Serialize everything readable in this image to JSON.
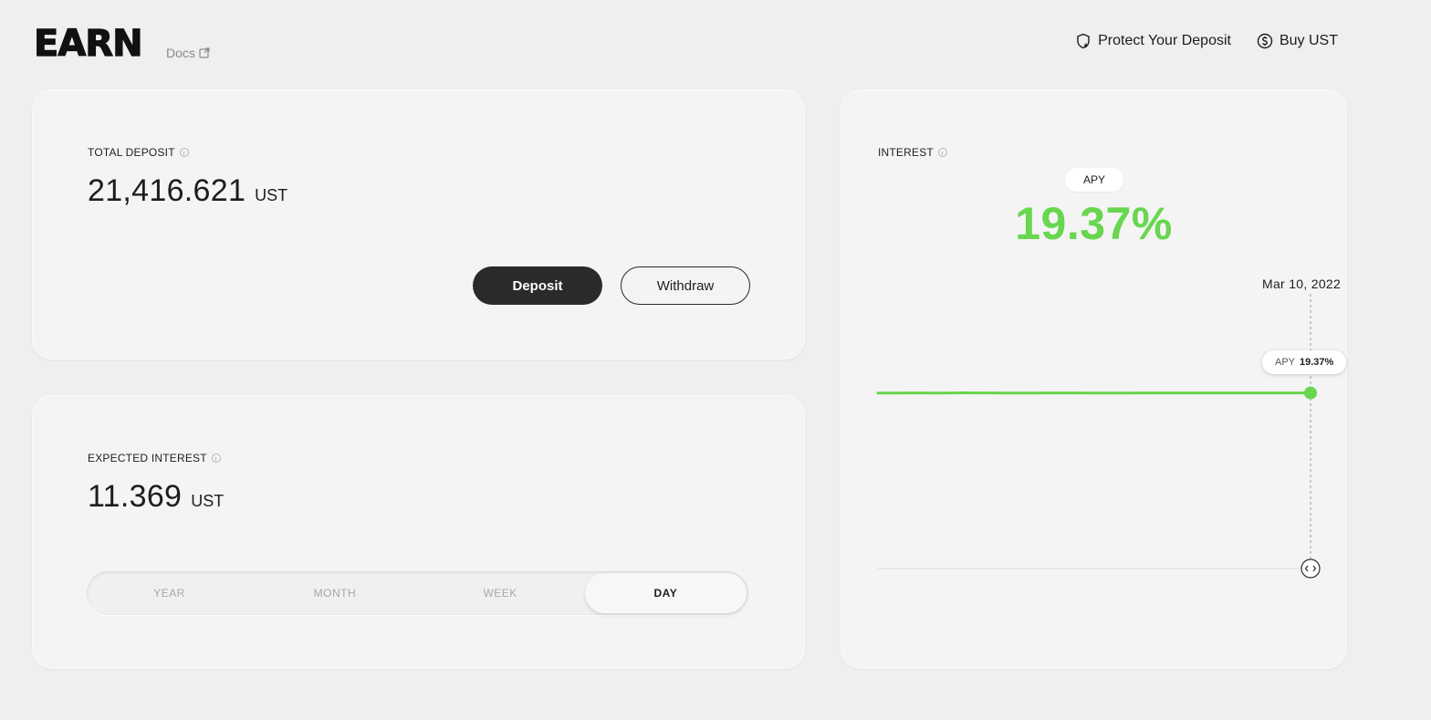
{
  "header": {
    "title": "EARN",
    "docs_label": "Docs",
    "actions": [
      {
        "label": "Protect Your Deposit",
        "icon": "shield-plus-icon"
      },
      {
        "label": "Buy UST",
        "icon": "dollar-circle-icon"
      }
    ]
  },
  "total_deposit": {
    "label": "TOTAL DEPOSIT",
    "value": "21,416.621",
    "unit": "UST",
    "deposit_label": "Deposit",
    "withdraw_label": "Withdraw"
  },
  "expected_interest": {
    "label": "EXPECTED INTEREST",
    "value": "11.369",
    "unit": "UST",
    "periods": [
      "YEAR",
      "MONTH",
      "WEEK",
      "DAY"
    ],
    "selected_period": "DAY"
  },
  "interest": {
    "label": "INTEREST",
    "apy_label": "APY",
    "apy_value": "19.37%",
    "tooltip_label": "APY",
    "tooltip_value": "19.37%",
    "selected_date": "Mar 10, 2022"
  },
  "colors": {
    "accent_green": "#68d64f",
    "primary_button": "#2a2a2a",
    "background": "#efefef"
  },
  "chart_data": {
    "type": "line",
    "series": [
      {
        "values": [
          19.36,
          19.37,
          19.36,
          19.38,
          19.37,
          19.36,
          19.37,
          19.37,
          19.36,
          19.37,
          19.37,
          19.37,
          19.37,
          19.37,
          19.37,
          19.37
        ]
      }
    ],
    "ylim": [
      0,
      40
    ],
    "grid": false
  }
}
